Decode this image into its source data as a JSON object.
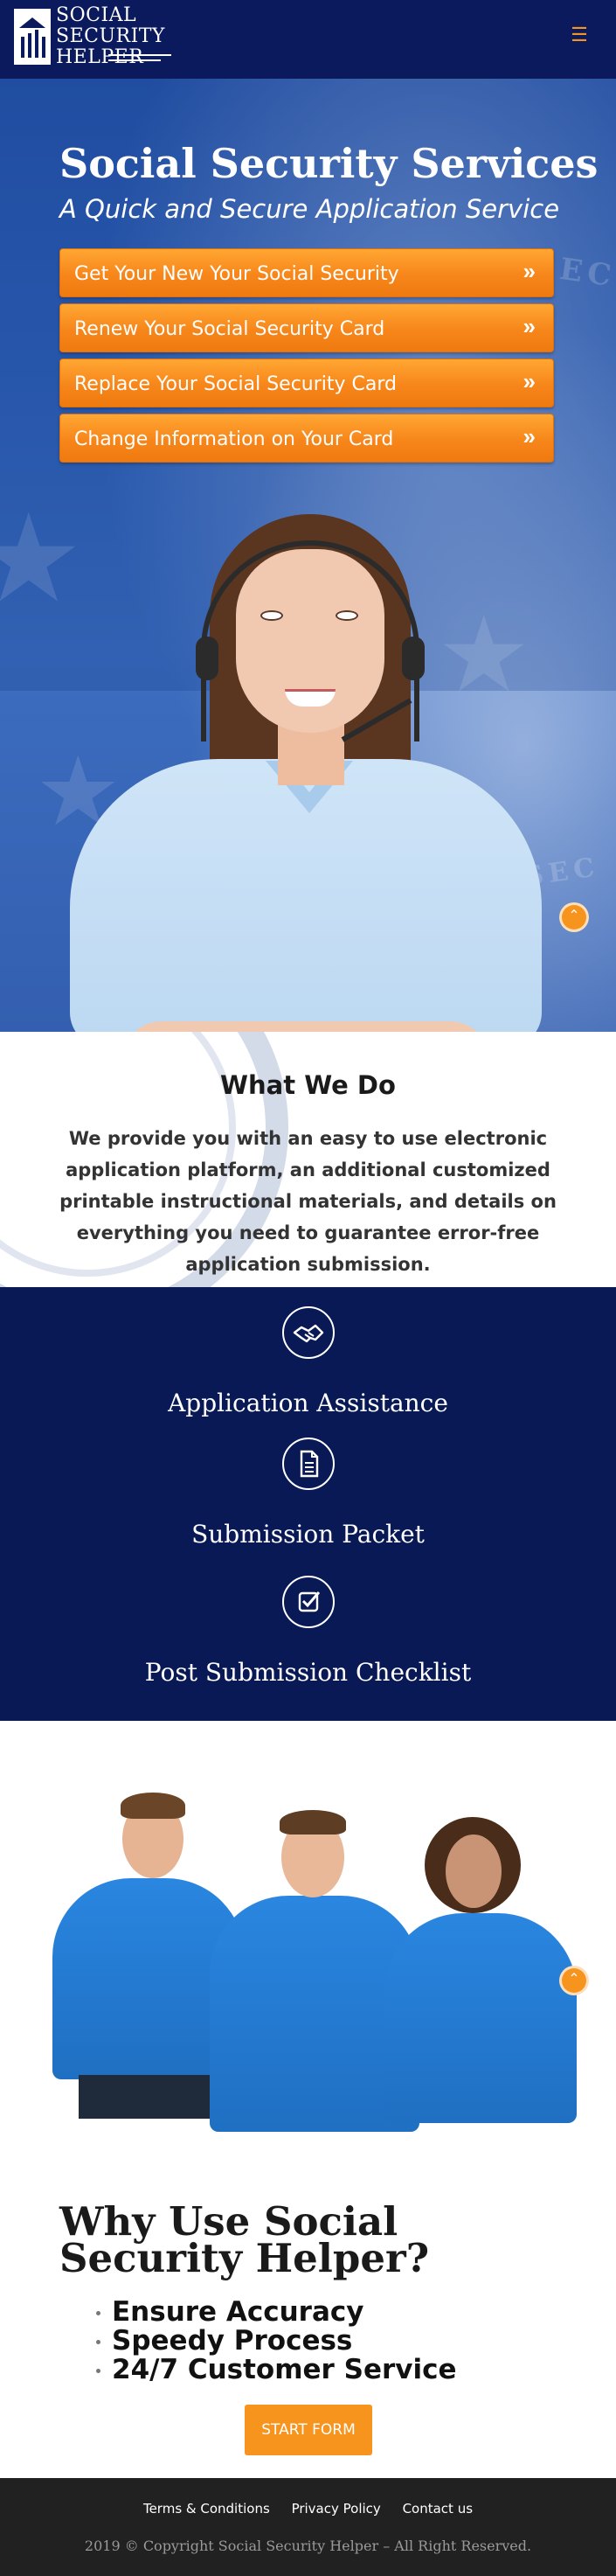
{
  "header": {
    "logo_line1": "SOCIAL",
    "logo_line2": "SECURITY",
    "logo_line3": "HELPER",
    "menu_icon": "hamburger-icon",
    "bg_color": "#0a1a5c",
    "accent_color": "#f7941d"
  },
  "hero": {
    "title": "Social Security Services",
    "subtitle": "A Quick and Secure Application Service",
    "buttons": [
      {
        "label": "Get Your New Your Social Security",
        "icon": "double-chevron-right-icon"
      },
      {
        "label": "Renew Your Social Security Card",
        "icon": "double-chevron-right-icon"
      },
      {
        "label": "Replace Your Social Security Card",
        "icon": "double-chevron-right-icon"
      },
      {
        "label": "Change Information on Your Card",
        "icon": "double-chevron-right-icon"
      }
    ]
  },
  "what_we_do": {
    "title": "What We Do",
    "text": "We provide you with an easy to use electronic application platform, an additional customized printable instructional materials, and details on everything you need to guarantee error-free application submission."
  },
  "services": [
    {
      "label": "Application Assistance",
      "icon": "handshake-icon"
    },
    {
      "label": "Submission Packet",
      "icon": "document-icon"
    },
    {
      "label": "Post Submission Checklist",
      "icon": "checkbox-icon"
    }
  ],
  "why": {
    "title": "Why Use Social Security Helper?",
    "items": [
      "Ensure Accuracy",
      "Speedy Process",
      "24/7 Customer Service"
    ],
    "button": "START FORM"
  },
  "footer": {
    "links": [
      "Terms & Conditions",
      "Privacy Policy",
      "Contact us"
    ],
    "copyright": "2019 © Copyright Social Security Helper – All Right Reserved."
  }
}
